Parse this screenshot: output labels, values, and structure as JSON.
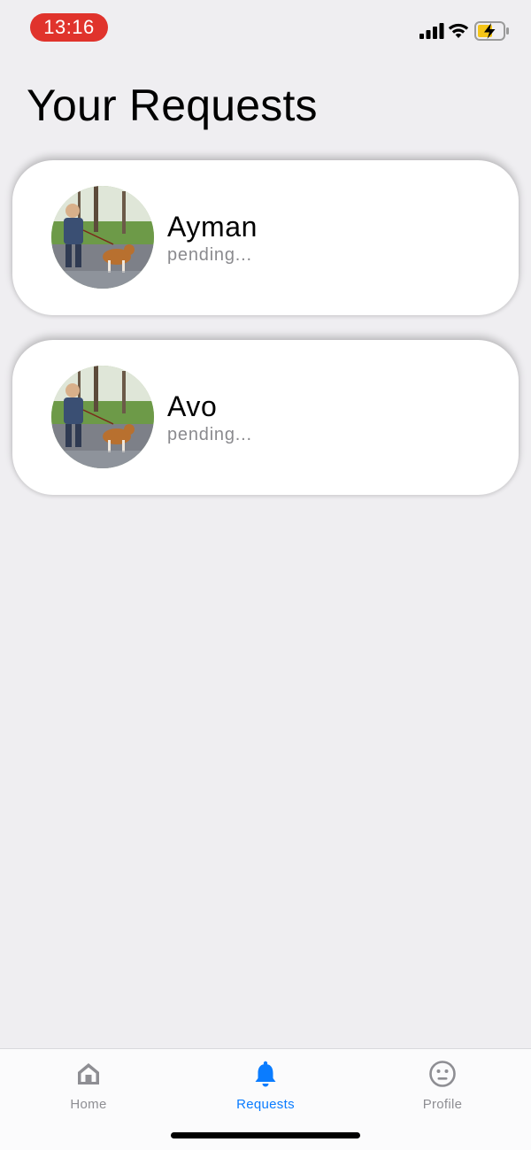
{
  "status_bar": {
    "time": "13:16",
    "time_pill_color": "#e0332c",
    "icons": [
      "signal-icon",
      "wifi-icon",
      "battery-charging-icon"
    ]
  },
  "page": {
    "title": "Your Requests"
  },
  "requests": [
    {
      "name": "Ayman",
      "status": "pending...",
      "avatar": "photo-child-walking-dog"
    },
    {
      "name": "Avo",
      "status": "pending...",
      "avatar": "photo-child-walking-dog"
    }
  ],
  "tab_bar": {
    "active": "Requests",
    "accent_color": "#0a7cff",
    "inactive_color": "#8e8e93",
    "tabs": [
      {
        "label": "Home",
        "icon": "home-icon"
      },
      {
        "label": "Requests",
        "icon": "bell-icon"
      },
      {
        "label": "Profile",
        "icon": "neutral-face-icon"
      }
    ]
  }
}
